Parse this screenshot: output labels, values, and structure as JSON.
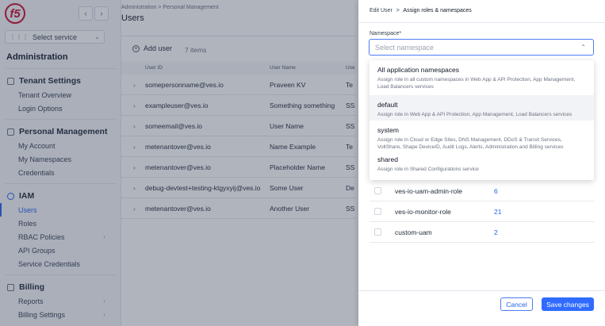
{
  "sidebar": {
    "logo": "f5",
    "select_service": "Select service",
    "section_title": "Administration",
    "groups": [
      {
        "title": "Tenant Settings",
        "items": [
          "Tenant Overview",
          "Login Options"
        ]
      },
      {
        "title": "Personal Management",
        "items": [
          "My Account",
          "My Namespaces",
          "Credentials"
        ]
      },
      {
        "title": "IAM",
        "items": [
          "Users",
          "Roles",
          "RBAC Policies",
          "API Groups",
          "Service Credentials"
        ]
      },
      {
        "title": "Billing",
        "items": [
          "Reports",
          "Billing Settings"
        ]
      }
    ],
    "active_item": "Users"
  },
  "main": {
    "breadcrumb": "Administration  >  Personal Management",
    "title": "Users",
    "add_user": "Add user",
    "items_count": "7 items",
    "columns": [
      "User ID",
      "User Name",
      "Use"
    ],
    "rows": [
      {
        "email": "somepersonname@ves.io",
        "name": "Praveen KV",
        "role": "Te"
      },
      {
        "email": "exampleuser@ves.io",
        "name": "Something something",
        "role": "SS"
      },
      {
        "email": "someemail@ves.io",
        "name": "User Name",
        "role": "SS"
      },
      {
        "email": "metenantover@ves.io",
        "name": "Name Example",
        "role": "Te"
      },
      {
        "email": "metenantover@ves.io",
        "name": "Placeholder Name",
        "role": "SS"
      },
      {
        "email": "debug-devtest+testing-ktgyxyij@ves.io",
        "name": "Some User",
        "role": "De"
      },
      {
        "email": "metenantover@ves.io",
        "name": "Another User",
        "role": "SS"
      }
    ]
  },
  "drawer": {
    "breadcrumb_parent": "Edit User",
    "breadcrumb_sep": ">",
    "breadcrumb_current": "Assign roles & namespaces",
    "namespace_label": "Namespace*",
    "namespace_placeholder": "Select namespace",
    "options": [
      {
        "title": "All application namespaces",
        "desc": "Assign role in all custom namespaces in Web App & API Protection, App Management, Load Balancers services"
      },
      {
        "title": "default",
        "desc": "Assign role in Web App & API Protection, App Management, Load Balancers services"
      },
      {
        "title": "system",
        "desc": "Assign role in Cloud or Edge Sites, DNS Management, DDoS & Transit Services, VoltShare, Shape DeviceID, Audit Logs, Alerts, Administration and Billing services"
      },
      {
        "title": "shared",
        "desc": "Assign role in Shared Configurations service"
      }
    ],
    "roles": [
      {
        "name": "ves-io-uam-admin-role",
        "count": "6"
      },
      {
        "name": "ves-io-monitor-role",
        "count": "21"
      },
      {
        "name": "custom-uam",
        "count": "2"
      }
    ],
    "cancel_label": "Cancel",
    "save_label": "Save changes"
  },
  "colors": {
    "accent": "#2f6bff",
    "logo": "#c8102e"
  }
}
